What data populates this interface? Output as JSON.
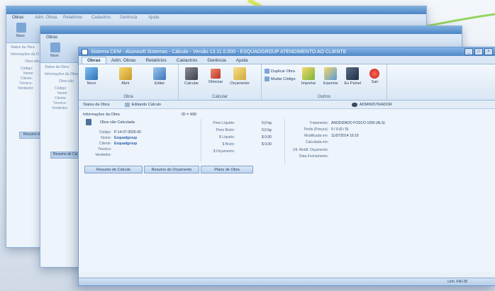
{
  "background_windows": {
    "win1": {
      "tab": "Obras",
      "menu": [
        "Adm. Obras",
        "Relatórios",
        "Cadastros",
        "Gerência",
        "Ajuda"
      ],
      "btn": "Novo",
      "labels": [
        "Status da Obra",
        "Informações da O",
        "Obra não",
        "Código:",
        "Nome:",
        "Cliente:",
        "Técnico:",
        "Vendedor:"
      ],
      "footer_btn": "Resumo do"
    },
    "win2": {
      "tab": "Obras",
      "btn": "Novo",
      "labels": [
        "Status da Obra:",
        "Informações da Obra",
        "Obra não",
        "Código:",
        "Nome:",
        "Cliente:",
        "Técnico:",
        "Vendedor:"
      ],
      "footer_btn": "Resumo de Cal"
    }
  },
  "window": {
    "title": "Sistema CEM - Alumisoft Sistemas - Cálculo - Versão 13.11.0.000 - ESQUADGROUP ATENDIMENTO AO CLIENTE",
    "controls": [
      "_",
      "□",
      "×"
    ]
  },
  "menu_tabs": [
    "Obras",
    "Adm. Obras",
    "Relatórios",
    "Cadastros",
    "Gerência",
    "Ajuda"
  ],
  "ribbon": {
    "groups": [
      {
        "label": "Obra",
        "buttons": [
          "Novo",
          "Abrir",
          "Editar"
        ]
      },
      {
        "label": "Calcular",
        "buttons": [
          "Calcular",
          "Otimizar",
          "Orçamento"
        ]
      },
      {
        "label": "Outros",
        "small": [
          "Duplicar Obra",
          "Mudar Código"
        ],
        "buttons": [
          "Importar",
          "Exportar",
          "Eu Painel",
          "Sair"
        ]
      }
    ]
  },
  "status": {
    "label": "Status da Obra:",
    "value": "Editando Cálculo",
    "user": "ADMINISTRADOR"
  },
  "info": {
    "title": "Informações da Obra",
    "id": "ID = 490",
    "obra_status": "Obra não Calculada",
    "fields": [
      {
        "k": "Código:",
        "v": "P-14-07-0026-00"
      },
      {
        "k": "Nome:",
        "v": "Esquadgroup"
      },
      {
        "k": "Cliente:",
        "v": "Esquadgroup"
      },
      {
        "k": "Técnico:",
        "v": ""
      },
      {
        "k": "Vendedor:",
        "v": ""
      }
    ],
    "pesos": [
      {
        "k": "Peso Líquido:",
        "v": "0,0 kg"
      },
      {
        "k": "Peso Bruto:",
        "v": "0,0 kg"
      },
      {
        "k": "$ Líquido:",
        "v": "$ 0,00"
      },
      {
        "k": "$ Bruto:",
        "v": "$ 0,00"
      },
      {
        "k": "$ Orçamento:",
        "v": ""
      }
    ],
    "meta": [
      {
        "k": "Tratamento:",
        "v": "ANODIZADO FOSCO-1000 (ALS)"
      },
      {
        "k": "Perfis (Preços):",
        "v": "0 / 0  (0 / 0)"
      },
      {
        "k": "Modificada em:",
        "v": "11/07/2014  15:10"
      },
      {
        "k": "Calculada em:",
        "v": ""
      },
      {
        "k": "Ult. Modif. Orçamento:",
        "v": ""
      },
      {
        "k": "Data Fechamento:",
        "v": ""
      }
    ]
  },
  "bottom_buttons": [
    "Resumo de Cálculo",
    "Resumo do Orçamento",
    "Plano de Obra"
  ],
  "footer": {
    "text": "Linh. 640-38"
  },
  "colors": {
    "accent": "#4f87c6",
    "swoosh_yellow": "#d8e64a",
    "swoosh_green": "#7fcc3a"
  }
}
